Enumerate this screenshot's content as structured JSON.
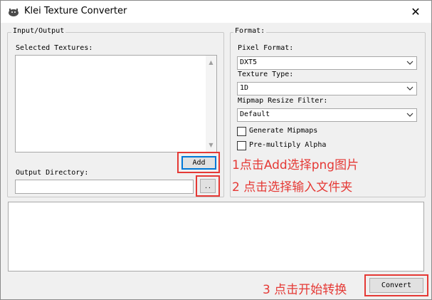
{
  "window": {
    "title": "Klei Texture Converter",
    "close_glyph": "✕",
    "icon": "klei-logo-icon"
  },
  "io_group": {
    "legend": "Input/Output",
    "selected_textures_label": "Selected Textures:",
    "add_button": "Add",
    "output_directory_label": "Output Directory:",
    "output_directory_value": "",
    "browse_button": ".."
  },
  "format_group": {
    "legend": "Format:",
    "pixel_format_label": "Pixel Format:",
    "pixel_format_value": "DXT5",
    "texture_type_label": "Texture Type:",
    "texture_type_value": "1D",
    "mipmap_filter_label": "Mipmap Resize Filter:",
    "mipmap_filter_value": "Default",
    "generate_mipmaps_label": "Generate Mipmaps",
    "generate_mipmaps_checked": false,
    "premultiply_alpha_label": "Pre-multiply Alpha",
    "premultiply_alpha_checked": false
  },
  "log": {
    "text": ""
  },
  "convert_button": "Convert",
  "annotations": {
    "step1": "1点击Add选择png图片",
    "step2": "2 点击选择输入文件夹",
    "step3": "3 点击开始转换",
    "color": "#e53935"
  }
}
